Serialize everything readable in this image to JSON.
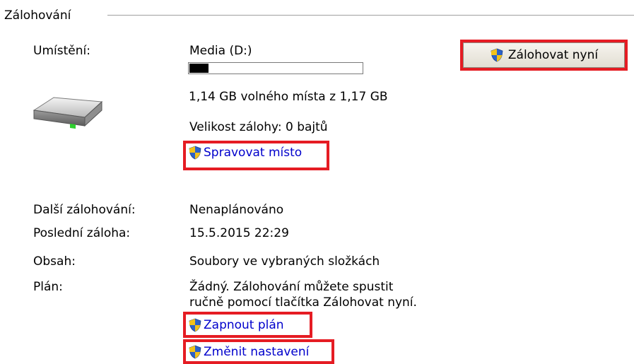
{
  "group": {
    "title": "Zálohování"
  },
  "location": {
    "label": "Umístění:",
    "drive": "Media (D:)",
    "used_fraction": 0.026,
    "free_text": "1,14 GB volného místa z 1,17 GB",
    "backup_size": "Velikost zálohy: 0 bajtů",
    "manage_space_link": "Spravovat místo"
  },
  "backup_now_button": "Zálohovat nyní",
  "details": [
    {
      "label": "Další zálohování:",
      "value": "Nenaplánováno"
    },
    {
      "label": "Poslední záloha:",
      "value": "15.5.2015 22:29"
    },
    {
      "label": "Obsah:",
      "value": "Soubory ve vybraných složkách"
    },
    {
      "label": "Plán:",
      "value_line1": "Žádný. Zálohování můžete spustit",
      "value_line2": "ručně pomocí tlačítka Zálohovat nyní."
    }
  ],
  "links": {
    "turn_on_schedule": "Zapnout plán",
    "change_settings": "Změnit nastavení"
  },
  "colors": {
    "highlight": "#e51c23",
    "link": "#0000cc"
  },
  "icons": [
    "shield-icon",
    "hard-drive-icon"
  ]
}
